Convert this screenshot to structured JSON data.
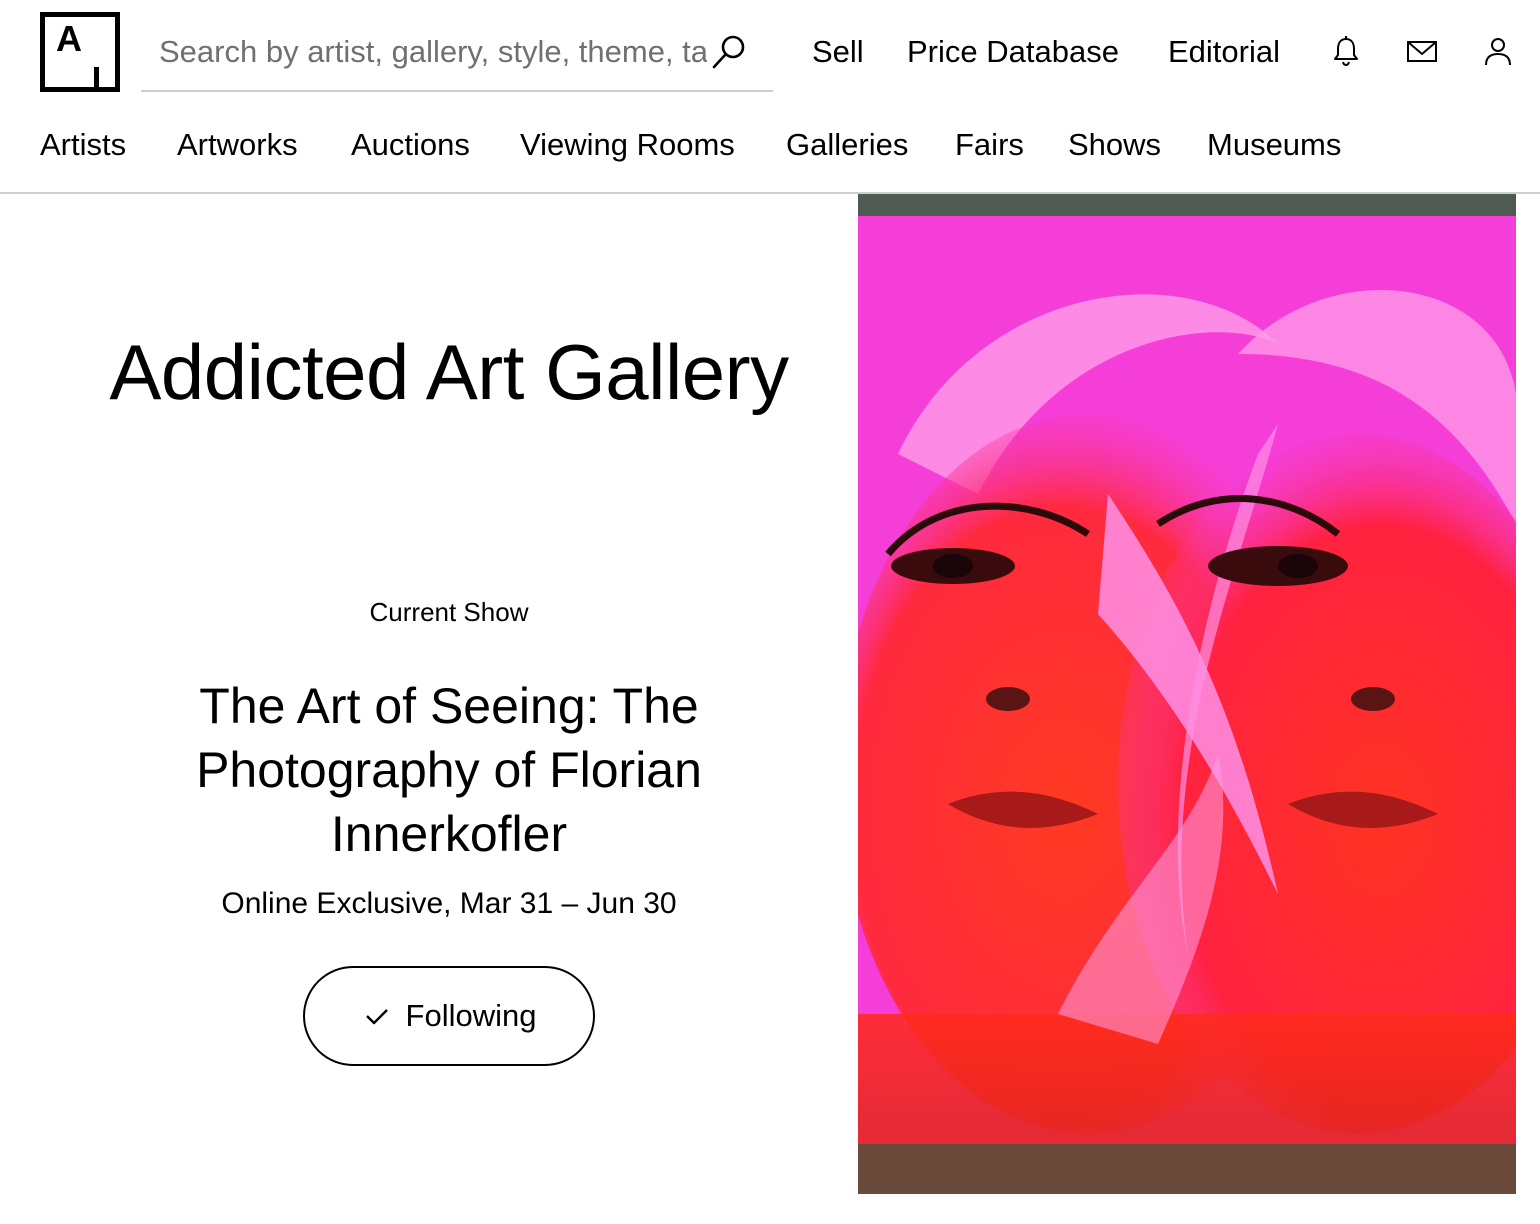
{
  "brand": {
    "logo_letter": "A"
  },
  "search": {
    "placeholder": "Search by artist, gallery, style, theme, tag, etc."
  },
  "header_links": {
    "sell": "Sell",
    "price_database": "Price Database",
    "editorial": "Editorial"
  },
  "header_icons": [
    "bell-icon",
    "envelope-icon",
    "user-icon"
  ],
  "nav": {
    "items": [
      "Artists",
      "Artworks",
      "Auctions",
      "Viewing Rooms",
      "Galleries",
      "Fairs",
      "Shows",
      "Museums"
    ]
  },
  "gallery": {
    "name": "Addicted Art Gallery"
  },
  "current_show": {
    "kicker": "Current Show",
    "title": "The Art of Seeing: The Photography of Florian Innerkofler",
    "dates": "Online Exclusive, Mar 31 – Jun 30",
    "follow_label": "Following"
  },
  "colors": {
    "text": "#000000",
    "divider": "#cfcfcf",
    "placeholder": "#707070",
    "artwork_magenta": "#f53ed8",
    "artwork_red": "#ff2a1c",
    "artwork_frame": "#4f5a52"
  }
}
